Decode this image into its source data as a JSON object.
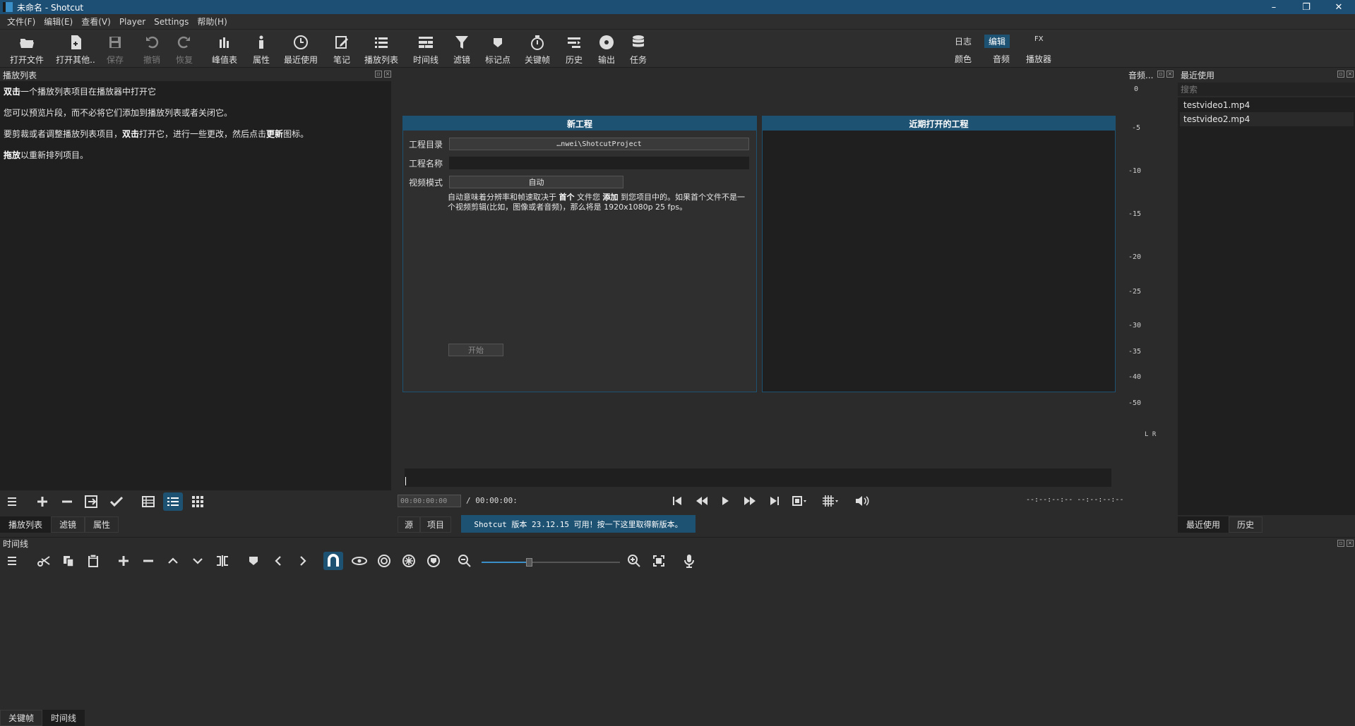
{
  "window": {
    "title": "未命名 - Shotcut",
    "minimize": "–",
    "restore": "❐",
    "close": "✕"
  },
  "menu": [
    "文件(F)",
    "编辑(E)",
    "查看(V)",
    "Player",
    "Settings",
    "帮助(H)"
  ],
  "toolbar": [
    {
      "label": "打开文件",
      "icon": "folder-open-icon",
      "enabled": true
    },
    {
      "label": "打开其他..",
      "icon": "file-plus-icon",
      "enabled": true
    },
    {
      "label": "保存",
      "icon": "save-icon",
      "enabled": false
    },
    {
      "label": "撤销",
      "icon": "undo-icon",
      "enabled": false
    },
    {
      "label": "恢复",
      "icon": "redo-icon",
      "enabled": false
    },
    {
      "label": "峰值表",
      "icon": "peak-meter-icon",
      "enabled": true
    },
    {
      "label": "属性",
      "icon": "info-icon",
      "enabled": true
    },
    {
      "label": "最近使用",
      "icon": "clock-icon",
      "enabled": true
    },
    {
      "label": "笔记",
      "icon": "notes-icon",
      "enabled": true
    },
    {
      "label": "播放列表",
      "icon": "list-icon",
      "enabled": true
    },
    {
      "label": "时间线",
      "icon": "timeline-icon",
      "enabled": true
    },
    {
      "label": "滤镜",
      "icon": "filter-icon",
      "enabled": true
    },
    {
      "label": "标记点",
      "icon": "marker-icon",
      "enabled": true
    },
    {
      "label": "关键帧",
      "icon": "stopwatch-icon",
      "enabled": true
    },
    {
      "label": "历史",
      "icon": "history-icon",
      "enabled": true
    },
    {
      "label": "输出",
      "icon": "disc-icon",
      "enabled": true
    },
    {
      "label": "任务",
      "icon": "database-icon",
      "enabled": true
    }
  ],
  "workspaces": {
    "log": "日志",
    "edit": "编辑",
    "fx": "FX",
    "color": "颜色",
    "audio": "音频",
    "player": "播放器",
    "active": "编辑"
  },
  "playlist": {
    "title": "播放列表",
    "lines": [
      {
        "bold": "双击",
        "text": "一个播放列表项目在播放器中打开它"
      },
      {
        "bold": "",
        "text": "您可以预览片段，而不必将它们添加到播放列表或者关闭它。"
      },
      {
        "parts": [
          "要剪裁或者调整播放列表项目，",
          "双击",
          "打开它，进行一些更改，然后点击",
          "更新",
          "图标。"
        ]
      },
      {
        "bold": "拖放",
        "text": "以重新排列项目。"
      }
    ],
    "tabs": [
      "播放列表",
      "滤镜",
      "属性"
    ]
  },
  "new_project": {
    "header": "新工程",
    "dir_label": "工程目录",
    "dir_value": "…nwei\\ShotcutProject",
    "name_label": "工程名称",
    "name_value": "",
    "mode_label": "视频模式",
    "mode_value": "自动",
    "desc_a": "自动意味着分辨率和帧速取决于 ",
    "desc_b": "首个",
    "desc_c": " 文件您 ",
    "desc_d": "添加",
    "desc_e": " 到您项目中的。如果首个文件不是一个视频剪辑(比如，图像或者音频)，那么将是 1920x1080p 25 fps。",
    "start_button": "开始"
  },
  "recent_projects": {
    "header": "近期打开的工程"
  },
  "player": {
    "timecode": "00:00:00:00",
    "duration": "/ 00:00:00:",
    "in_out": "--:--:--:-- --:--:--:--",
    "tabs": [
      "源",
      "项目"
    ],
    "update_notice": "Shotcut 版本 23.12.15 可用！按一下这里取得新版本。"
  },
  "audio_meter": {
    "title": "音频...",
    "scale": [
      "0",
      "-5",
      "-10",
      "-15",
      "-20",
      "-25",
      "-30",
      "-35",
      "-40",
      "-50"
    ],
    "channels": "L R"
  },
  "recent": {
    "title": "最近使用",
    "search_placeholder": "搜索",
    "items": [
      "testvideo1.mp4",
      "testvideo2.mp4"
    ],
    "tabs": [
      "最近使用",
      "历史"
    ]
  },
  "timeline": {
    "title": "时间线",
    "zoom_level": 0.35,
    "bottom_tabs": [
      "关键帧",
      "时间线"
    ]
  },
  "colors": {
    "accent": "#1d5273",
    "titlebar": "#1d4e73",
    "panel": "#1f1f1f"
  }
}
